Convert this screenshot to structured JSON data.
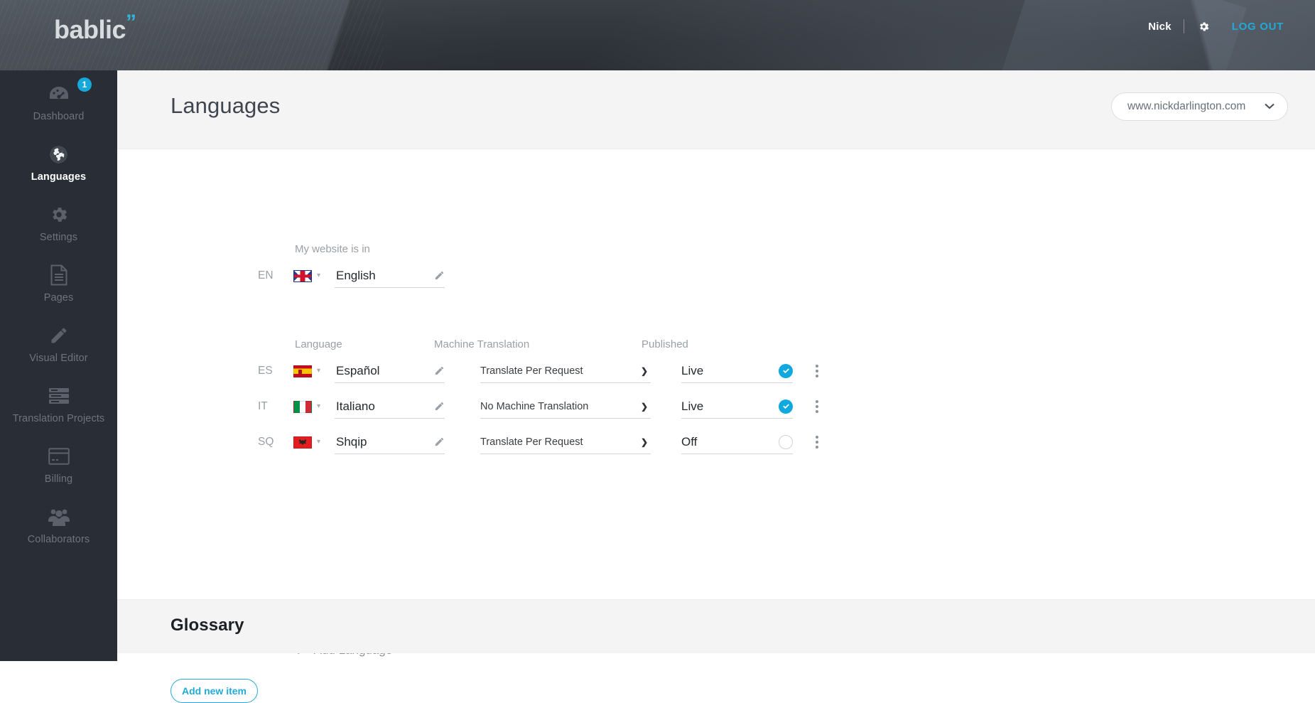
{
  "brand": {
    "logo_text": "bablic",
    "logo_quote": "”",
    "accent_color": "#23a9d6",
    "toggle_on_color": "#0fa9dd",
    "sidebar_color": "#282d36",
    "topbar_color": "#31353c"
  },
  "topbar": {
    "user_name": "Nick",
    "settings_icon": "gear-icon",
    "logout_label": "LOG OUT"
  },
  "sidebar": {
    "items": [
      {
        "label": "Dashboard",
        "icon": "dashboard-gauge-icon",
        "active": false,
        "badge": "1"
      },
      {
        "label": "Languages",
        "icon": "globe-icon",
        "active": true,
        "badge": null
      },
      {
        "label": "Settings",
        "icon": "gear-icon",
        "active": false,
        "badge": null
      },
      {
        "label": "Pages",
        "icon": "document-icon",
        "active": false,
        "badge": null
      },
      {
        "label": "Visual Editor",
        "icon": "pencil-icon",
        "active": false,
        "badge": null
      },
      {
        "label": "Translation Projects",
        "icon": "server-list-icon",
        "active": false,
        "badge": null
      },
      {
        "label": "Billing",
        "icon": "credit-card-icon",
        "active": false,
        "badge": null
      },
      {
        "label": "Collaborators",
        "icon": "people-group-icon",
        "active": false,
        "badge": null
      }
    ]
  },
  "page": {
    "title": "Languages",
    "site_selector": {
      "value": "www.nickdarlington.com",
      "caret_icon": "chevron-down-icon"
    }
  },
  "source_language": {
    "header": "My website is in",
    "code": "EN",
    "flag": "flag-gb",
    "name": "English",
    "edit_icon": "pencil-icon"
  },
  "table": {
    "headers": {
      "language": "Language",
      "machine_translation": "Machine Translation",
      "published": "Published"
    },
    "mt_options": [
      "Translate Per Request",
      "No Machine Translation"
    ],
    "rows": [
      {
        "code": "ES",
        "flag": "flag-es",
        "name": "Español",
        "machine_translation": "Translate Per Request",
        "published_label": "Live",
        "published_on": true
      },
      {
        "code": "IT",
        "flag": "flag-it",
        "name": "Italiano",
        "machine_translation": "No Machine Translation",
        "published_label": "Live",
        "published_on": true
      },
      {
        "code": "SQ",
        "flag": "flag-sq",
        "name": "Shqip",
        "machine_translation": "Translate Per Request",
        "published_label": "Off",
        "published_on": false
      }
    ]
  },
  "add_language": {
    "plus": "+",
    "label": "Add Language"
  },
  "glossary": {
    "title": "Glossary",
    "add_button_label": "Add new item"
  }
}
